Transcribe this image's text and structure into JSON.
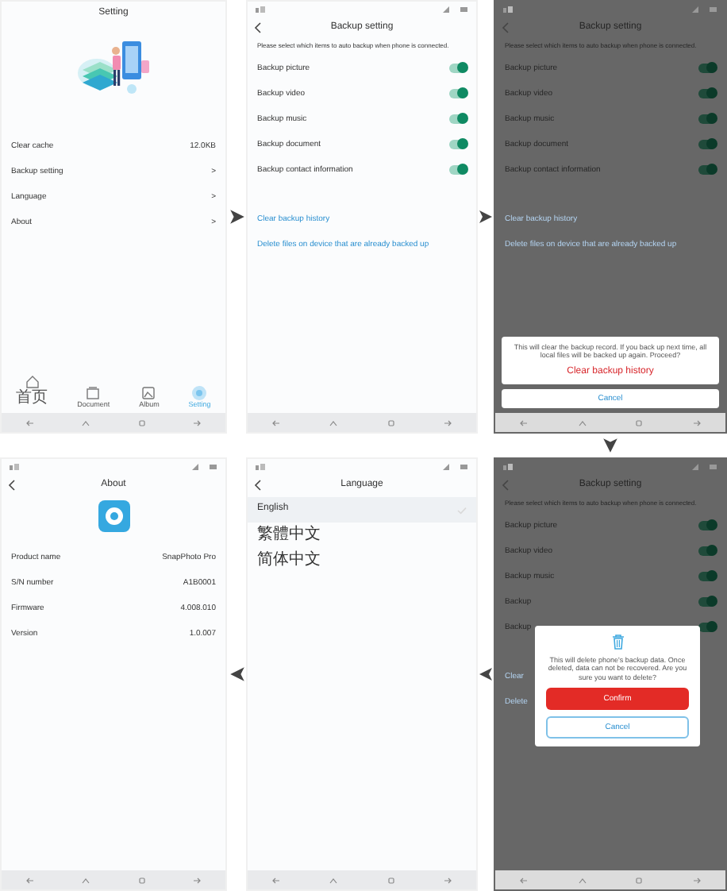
{
  "top_row": [
    {
      "kind": "settings",
      "title": "Setting",
      "items": [
        {
          "label": "Clear cache",
          "value": "12.0KB"
        },
        {
          "label": "Backup setting",
          "value": ">"
        },
        {
          "label": "Language",
          "value": ">"
        },
        {
          "label": "About",
          "value": ">"
        }
      ],
      "tabs": [
        {
          "label": "首页",
          "selected": false
        },
        {
          "label": "Document",
          "selected": false
        },
        {
          "label": "Album",
          "selected": false
        },
        {
          "label": "Setting",
          "selected": true
        }
      ]
    },
    {
      "kind": "backup",
      "status_bar": true,
      "title": "Backup setting",
      "note": "Please select which items to auto backup when phone is connected.",
      "toggles": [
        {
          "label": "Backup picture",
          "on": true
        },
        {
          "label": "Backup video",
          "on": true
        },
        {
          "label": "Backup music",
          "on": true
        },
        {
          "label": "Backup document",
          "on": true
        },
        {
          "label": "Backup contact information",
          "on": true
        }
      ],
      "links": [
        "Clear backup history",
        "Delete files on device that are already backed up"
      ]
    },
    {
      "kind": "backup",
      "status_bar": true,
      "dimmed": true,
      "title": "Backup setting",
      "note": "Please select which items to auto backup when phone is connected.",
      "toggles": [
        {
          "label": "Backup picture",
          "on": true
        },
        {
          "label": "Backup video",
          "on": true
        },
        {
          "label": "Backup music",
          "on": true
        },
        {
          "label": "Backup document",
          "on": true
        },
        {
          "label": "Backup contact information",
          "on": true
        }
      ],
      "links": [
        "Clear backup history",
        "Delete files on device that are already backed up"
      ],
      "overlay": {
        "kind": "sheet",
        "message": "This will clear the backup record. If you back up next time, all local files will be backed up again. Proceed?",
        "buttons": [
          {
            "label": "Clear backup history",
            "kind": "danger"
          },
          {
            "label": "Cancel",
            "kind": "plain"
          }
        ]
      }
    }
  ],
  "bottom_row": [
    {
      "kind": "about",
      "status_bar": true,
      "title": "About",
      "items": [
        {
          "label": "Product name",
          "value": "SnapPhoto Pro"
        },
        {
          "label": "S/N number",
          "value": "A1B0001"
        },
        {
          "label": "Firmware",
          "value": "4.008.010"
        },
        {
          "label": "Version",
          "value": "1.0.007"
        }
      ]
    },
    {
      "kind": "language",
      "status_bar": true,
      "title": "Language",
      "items": [
        {
          "label": "English",
          "selected": true
        },
        {
          "label": "繁體中文",
          "selected": false
        },
        {
          "label": "简体中文",
          "selected": false
        }
      ]
    },
    {
      "kind": "backup",
      "status_bar": true,
      "dimmed": true,
      "title": "Backup setting",
      "note": "Please select which items to auto backup when phone is connected.",
      "toggles": [
        {
          "label": "Backup picture",
          "on": true
        },
        {
          "label": "Backup video",
          "on": true
        },
        {
          "label": "Backup music",
          "on": true
        },
        {
          "label": "Backup",
          "on": true
        },
        {
          "label": "Backup",
          "on": true
        }
      ],
      "links": [
        "Clear",
        "Delete"
      ],
      "overlay": {
        "kind": "dialog",
        "message": "This will delete phone's backup data. Once deleted, data can not be recovered. Are you sure you want to delete?",
        "buttons": [
          {
            "label": "Confirm",
            "kind": "filled"
          },
          {
            "label": "Cancel",
            "kind": "outline"
          }
        ]
      }
    }
  ]
}
